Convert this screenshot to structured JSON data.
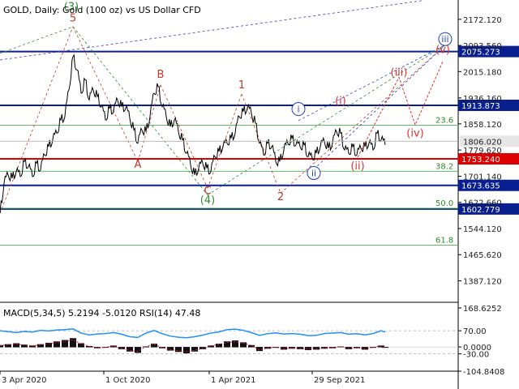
{
  "chart_data": {
    "type": "line",
    "symbol": "GOLD",
    "timeframe": "Daily",
    "description": "Gold (100 oz) vs US Dollar CFD",
    "header": "GOLD, Daily:  Gold (100 oz) vs US Dollar CFD",
    "ylim": [
      1330,
      2230
    ],
    "y_ticks": [
      "2172.120",
      "2093.560",
      "2015.180",
      "1936.160",
      "1858.120",
      "1779.620",
      "1701.140",
      "1622.660",
      "1544.120",
      "1465.620",
      "1387.120"
    ],
    "x_ticks": [
      "3 Apr 2020",
      "1 Oct 2020",
      "1 Apr 2021",
      "29 Sep 2021"
    ],
    "last_price": "1806.020",
    "levels": [
      {
        "name": "resistance-1",
        "value": 2075.273,
        "label": "2075.273",
        "color": "#0a1f8f"
      },
      {
        "name": "resistance-2",
        "value": 1913.873,
        "label": "1913.873",
        "color": "#0a1f8f"
      },
      {
        "name": "support-1",
        "value": 1753.24,
        "label": "1753.240",
        "color": "#dd0000"
      },
      {
        "name": "support-2",
        "value": 1673.635,
        "label": "1673.635",
        "color": "#0a1f8f"
      },
      {
        "name": "support-3",
        "value": 1602.779,
        "label": "1602.779",
        "color": "#0a1f8f"
      }
    ],
    "fibonacci": [
      {
        "label": "23.6",
        "value": 1854
      },
      {
        "label": "38.2",
        "value": 1716
      },
      {
        "label": "50.0",
        "value": 1605
      },
      {
        "label": "61.8",
        "value": 1494
      }
    ],
    "wave_labels": [
      {
        "text": "(3)",
        "t": 88,
        "p": 2200,
        "color": "#2e8b2e"
      },
      {
        "text": "5",
        "t": 90,
        "p": 2166,
        "color": "#c0392b"
      },
      {
        "text": "B",
        "t": 198,
        "p": 1997,
        "color": "#c0392b"
      },
      {
        "text": "A",
        "t": 170,
        "p": 1727,
        "color": "#c0392b"
      },
      {
        "text": "C",
        "t": 256,
        "p": 1647,
        "color": "#c0392b"
      },
      {
        "text": "(4)",
        "t": 256,
        "p": 1619,
        "color": "#2e8b2e"
      },
      {
        "text": "1",
        "t": 298,
        "p": 1965,
        "color": "#c0392b"
      },
      {
        "text": "2",
        "t": 346,
        "p": 1629,
        "color": "#c0392b"
      },
      {
        "text": "i",
        "t": 368,
        "p": 1893,
        "color": "#1f3fbf"
      },
      {
        "text": "ii",
        "t": 387,
        "p": 1701,
        "color": "#1f3fbf"
      },
      {
        "text": "iii",
        "t": 549,
        "p": 2103,
        "color": "#1f3fbf"
      },
      {
        "text": "(i)",
        "t": 420,
        "p": 1918,
        "color": "#e03030"
      },
      {
        "text": "(ii)",
        "t": 441,
        "p": 1722,
        "color": "#e03030"
      },
      {
        "text": "(iii)",
        "t": 492,
        "p": 2002,
        "color": "#e03030"
      },
      {
        "text": "(iv)",
        "t": 512,
        "p": 1820,
        "color": "#e03030"
      },
      {
        "text": "(v)",
        "t": 546,
        "p": 2071,
        "color": "#e03030"
      }
    ],
    "price_series": {
      "name": "GOLD",
      "t": [
        0,
        5,
        10,
        15,
        20,
        25,
        30,
        35,
        40,
        45,
        50,
        55,
        60,
        65,
        70,
        75,
        80,
        85,
        90,
        95,
        100,
        105,
        110,
        115,
        120,
        125,
        130,
        135,
        140,
        145,
        150,
        155,
        160,
        165,
        170,
        175,
        180,
        185,
        190,
        195,
        200,
        205,
        210,
        215,
        220,
        225,
        230,
        235,
        240,
        245,
        250,
        255,
        260,
        265,
        270,
        275,
        280,
        285,
        290,
        295,
        300,
        305,
        310,
        315,
        320,
        325,
        330,
        335,
        340,
        345,
        350,
        355,
        360,
        365,
        370,
        375,
        380,
        385,
        390,
        395,
        400,
        405,
        410,
        415,
        420,
        425,
        430,
        435,
        440,
        445,
        450,
        455,
        460,
        465,
        470,
        475
      ],
      "p": [
        1590,
        1680,
        1705,
        1695,
        1715,
        1700,
        1745,
        1730,
        1700,
        1740,
        1720,
        1765,
        1790,
        1810,
        1830,
        1870,
        1880,
        1960,
        2060,
        2020,
        1950,
        1990,
        1930,
        1960,
        1940,
        1910,
        1870,
        1905,
        1895,
        1930,
        1910,
        1905,
        1875,
        1840,
        1800,
        1840,
        1835,
        1880,
        1950,
        1970,
        1910,
        1880,
        1850,
        1870,
        1835,
        1810,
        1770,
        1735,
        1705,
        1725,
        1740,
        1725,
        1715,
        1760,
        1775,
        1790,
        1800,
        1815,
        1830,
        1880,
        1895,
        1905,
        1890,
        1860,
        1800,
        1765,
        1800,
        1790,
        1745,
        1745,
        1780,
        1800,
        1815,
        1795,
        1790,
        1795,
        1760,
        1755,
        1770,
        1790,
        1805,
        1785,
        1800,
        1835,
        1830,
        1780,
        1770,
        1790,
        1765,
        1785,
        1790,
        1800,
        1780,
        1830,
        1810,
        1795
      ]
    },
    "projected_path": {
      "t": [
        441,
        492,
        512,
        546
      ],
      "p": [
        1758,
        1998,
        1855,
        2045
      ]
    },
    "macd_panel": {
      "label": "MACD(5,34,5) 5.2194 -5.0120 RSI(14) 47.48",
      "y_ticks": [
        "168.6252",
        "70.00",
        "0.0000",
        "-30.00",
        "-104.8408"
      ],
      "ylim": [
        -104.8408,
        168.6252
      ],
      "t": [
        0,
        10,
        20,
        30,
        40,
        50,
        60,
        70,
        80,
        90,
        100,
        110,
        120,
        130,
        140,
        150,
        160,
        170,
        180,
        190,
        200,
        210,
        220,
        230,
        240,
        250,
        260,
        270,
        280,
        290,
        300,
        310,
        320,
        330,
        340,
        350,
        360,
        370,
        380,
        390,
        400,
        410,
        420,
        430,
        440,
        450,
        460,
        470,
        475
      ],
      "rsi": [
        70,
        66,
        62,
        67,
        64,
        72,
        69,
        73,
        75,
        78,
        60,
        52,
        56,
        58,
        62,
        55,
        44,
        41,
        60,
        71,
        57,
        47,
        42,
        40,
        44,
        51,
        60,
        65,
        75,
        77,
        72,
        62,
        50,
        57,
        61,
        56,
        58,
        55,
        49,
        50,
        58,
        60,
        62,
        55,
        57,
        52,
        58,
        70,
        64
      ],
      "hist": [
        8,
        12,
        16,
        10,
        6,
        12,
        18,
        24,
        30,
        38,
        16,
        4,
        -4,
        -2,
        6,
        -8,
        -18,
        -24,
        2,
        14,
        -4,
        -14,
        -20,
        -26,
        -18,
        -8,
        6,
        14,
        24,
        28,
        20,
        8,
        -16,
        -6,
        -2,
        -10,
        -6,
        -8,
        -12,
        -10,
        -6,
        -4,
        2,
        -8,
        -4,
        -10,
        -2,
        6,
        -2
      ]
    }
  }
}
